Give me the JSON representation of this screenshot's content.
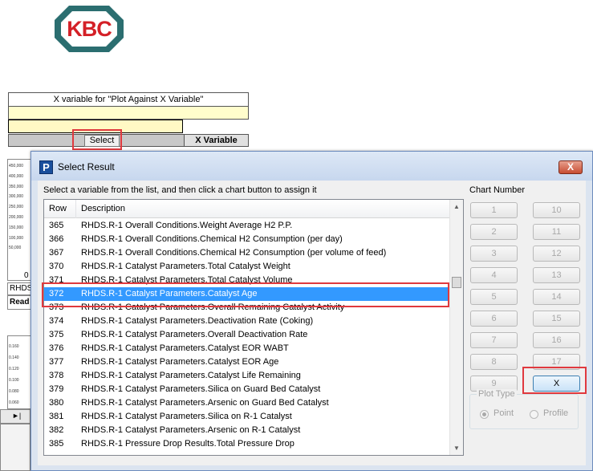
{
  "logo": {
    "text": "KBC"
  },
  "background": {
    "xvar_title": "X variable for \"Plot Against X Variable\"",
    "select_label": "Select",
    "x_variable_label": "X Variable",
    "chart1_ticks": [
      "450,000",
      "400,000",
      "350,000",
      "300,000",
      "250,000",
      "200,000",
      "150,000",
      "100,000",
      "50,000"
    ],
    "chart1_zero": "0",
    "strip_text_1": "RHDS",
    "strip_text_2": "Read",
    "chart2_ticks": [
      "0.160",
      "0.140",
      "0.120",
      "0.100",
      "0.080",
      "0.060"
    ]
  },
  "dialog": {
    "title": "Select Result",
    "close_label": "X",
    "instruction": "Select a variable from the list, and then click a chart button to assign it",
    "list": {
      "columns": {
        "row": "Row",
        "description": "Description"
      },
      "rows": [
        {
          "num": "365",
          "desc": "RHDS.R-1 Overall Conditions.Weight Average H2 P.P."
        },
        {
          "num": "366",
          "desc": "RHDS.R-1 Overall Conditions.Chemical H2 Consumption (per day)"
        },
        {
          "num": "367",
          "desc": "RHDS.R-1 Overall Conditions.Chemical H2 Consumption (per volume of feed)"
        },
        {
          "num": "370",
          "desc": "RHDS.R-1 Catalyst Parameters.Total Catalyst Weight"
        },
        {
          "num": "371",
          "desc": "RHDS.R-1 Catalyst Parameters.Total Catalyst Volume"
        },
        {
          "num": "372",
          "desc": "RHDS.R-1 Catalyst Parameters.Catalyst Age"
        },
        {
          "num": "373",
          "desc": "RHDS.R-1 Catalyst Parameters.Overall Remaining Catalyst Activity"
        },
        {
          "num": "374",
          "desc": "RHDS.R-1 Catalyst Parameters.Deactivation Rate (Coking)"
        },
        {
          "num": "375",
          "desc": "RHDS.R-1 Catalyst Parameters.Overall Deactivation Rate"
        },
        {
          "num": "376",
          "desc": "RHDS.R-1 Catalyst Parameters.Catalyst EOR WABT"
        },
        {
          "num": "377",
          "desc": "RHDS.R-1 Catalyst Parameters.Catalyst EOR Age"
        },
        {
          "num": "378",
          "desc": "RHDS.R-1 Catalyst Parameters.Catalyst Life Remaining"
        },
        {
          "num": "379",
          "desc": "RHDS.R-1 Catalyst Parameters.Silica on Guard Bed Catalyst"
        },
        {
          "num": "380",
          "desc": "RHDS.R-1 Catalyst Parameters.Arsenic on Guard Bed Catalyst"
        },
        {
          "num": "381",
          "desc": "RHDS.R-1 Catalyst Parameters.Silica on R-1 Catalyst"
        },
        {
          "num": "382",
          "desc": "RHDS.R-1 Catalyst Parameters.Arsenic on R-1 Catalyst"
        },
        {
          "num": "385",
          "desc": "RHDS.R-1 Pressure Drop Results.Total Pressure Drop"
        }
      ],
      "selected_row": "372"
    },
    "chart_number_label": "Chart Number",
    "chart_buttons": {
      "left": [
        "1",
        "2",
        "3",
        "4",
        "5",
        "6",
        "7",
        "8",
        "9"
      ],
      "right": [
        "10",
        "11",
        "12",
        "13",
        "14",
        "15",
        "16",
        "17",
        "X"
      ]
    },
    "plot_type": {
      "label": "Plot Type",
      "options": [
        "Point",
        "Profile"
      ],
      "selected": "Point"
    }
  },
  "colors": {
    "selection": "#3399ff",
    "highlight_box": "#e0393e",
    "logo_red": "#d42027",
    "logo_teal": "#2b6e70"
  }
}
